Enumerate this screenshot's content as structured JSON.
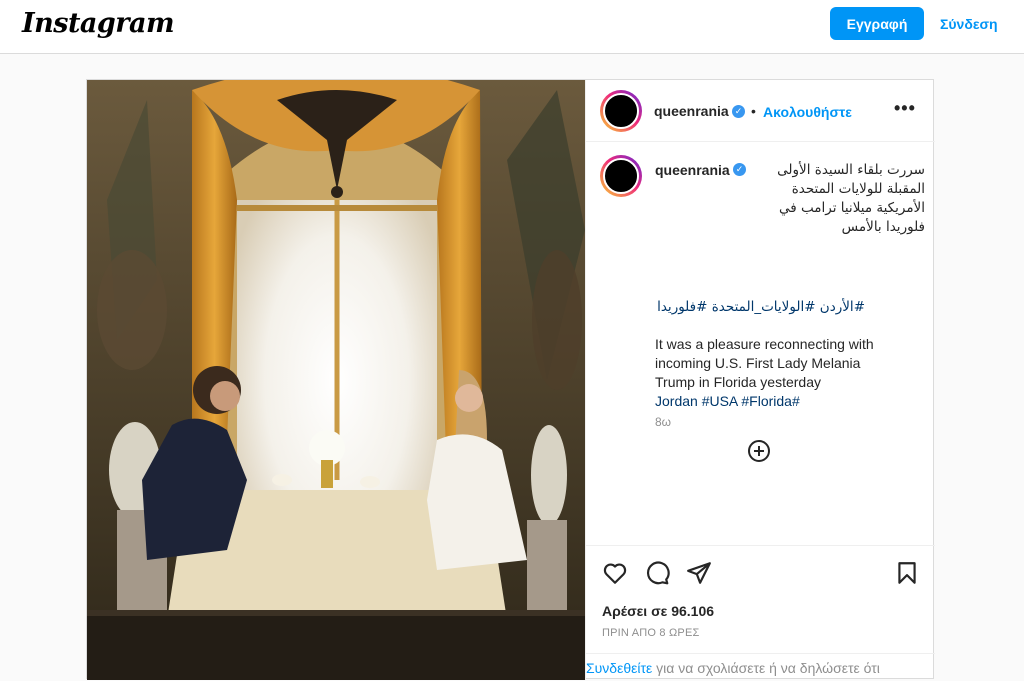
{
  "topbar": {
    "logo": "Instagram",
    "signup_label": "Εγγραφή",
    "login_label": "Σύνδεση"
  },
  "post": {
    "username": "queenrania",
    "verified_mark": "✓",
    "follow_label": "Ακολουθήστε",
    "separator": "•",
    "more_label": "•••",
    "caption_arabic": "سررت بلقاء السيدة الأولى المقبلة للولايات المتحدة الأمريكية ميلانيا ترامب في فلوريدا بالأمس",
    "hashtags_arabic": "#الأردن #الولايات_المتحدة #فلوريدا",
    "caption_english": "It was a pleasure reconnecting with incoming U.S. First Lady Melania Trump in Florida yesterday",
    "hashtags_english": "Jordan #USA #Florida#",
    "time_ago": "8ω",
    "likes": "Αρέσει σε 96.106",
    "post_time": "ΠΡΙΝ ΑΠΟ 8 ΩΡΕΣ",
    "login_prompt_link": "Συνδεθείτε",
    "login_prompt_text": " για να σχολιάσετε ή να δηλώσετε ότι"
  },
  "icons": {
    "like": "heart-icon",
    "comment": "comment-icon",
    "share": "send-icon",
    "save": "bookmark-icon",
    "add_comment": "plus-circle-icon",
    "more": "more-options-icon"
  },
  "colors": {
    "accent": "#0095f6",
    "hashtag": "#00376b",
    "muted": "#8e8e8e",
    "border": "#dbdbdb"
  }
}
